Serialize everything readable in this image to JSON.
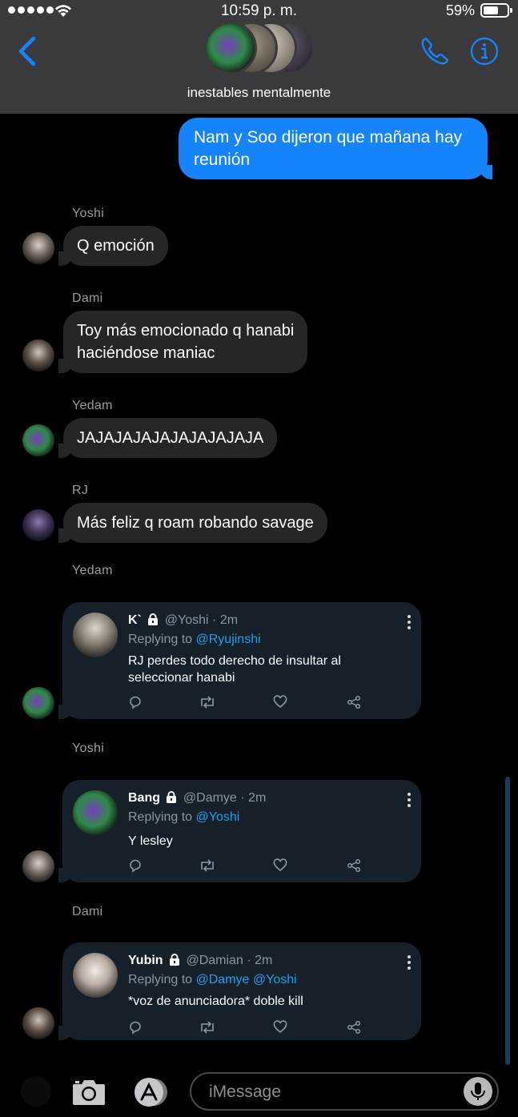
{
  "status_bar": {
    "time": "10:59 p. m.",
    "battery": "59%"
  },
  "header": {
    "group_name": "inestables mentalmente"
  },
  "outgoing": {
    "text": "Nam y Soo dijeron que mañana hay reunión"
  },
  "messages": [
    {
      "sender": "Yoshi",
      "text": "Q emoción"
    },
    {
      "sender": "Dami",
      "text_line1": "Toy más emocionado q hanabi",
      "text_line2": "haciéndose maniac"
    },
    {
      "sender": "Yedam",
      "text": "JAJAJAJAJAJAJAJAJAJA"
    },
    {
      "sender": "RJ",
      "text": "Más feliz q roam robando savage"
    },
    {
      "sender": "Yedam"
    },
    {
      "sender": "Yoshi"
    },
    {
      "sender": "Dami"
    }
  ],
  "tweets": [
    {
      "name": "K`",
      "handle": "@Yoshi · 2m",
      "replying_label": "Replying to",
      "mentions": "@Ryujinshi",
      "text_line1": "RJ perdes todo derecho de insultar al",
      "text_line2": "seleccionar hanabi"
    },
    {
      "name": "Bang",
      "handle": "@Damye · 2m",
      "replying_label": "Replying to",
      "mentions": "@Yoshi",
      "text_line1": "Y lesley"
    },
    {
      "name": "Yubin",
      "handle": "@Damian · 2m",
      "replying_label": "Replying to",
      "mentions": "@Damye @Yoshi",
      "text_line1": "*voz de anunciadora* doble kill"
    }
  ],
  "input": {
    "placeholder": "iMessage"
  },
  "colors": {
    "accent": "#1584fd",
    "bubble": "#262629",
    "tweet_bg": "#15202b",
    "mention": "#1da1f2"
  }
}
